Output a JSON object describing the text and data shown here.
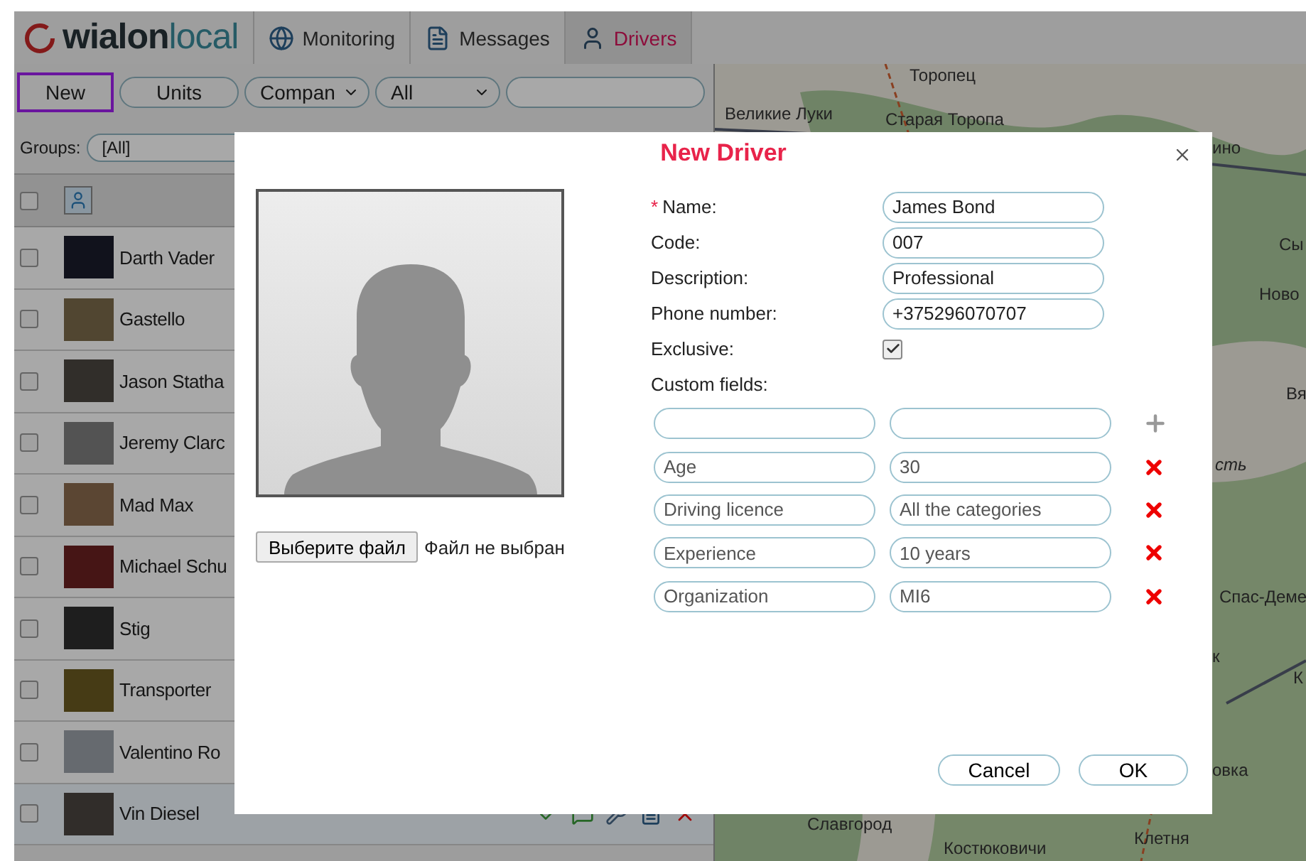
{
  "header": {
    "logo": {
      "part_1": "wialon",
      "part_2": "local"
    },
    "tabs": [
      {
        "label": "Monitoring",
        "selected": false
      },
      {
        "label": "Messages",
        "selected": false
      },
      {
        "label": "Drivers",
        "selected": true
      }
    ]
  },
  "toolbar": {
    "new_button": {
      "label": "New",
      "highlighted": true
    },
    "units_button": {
      "label": "Units"
    },
    "dropdowns": [
      {
        "value": "Compan"
      },
      {
        "value": "All"
      }
    ]
  },
  "groups": {
    "label": "Groups:",
    "value": "[All]"
  },
  "select_all": {
    "checked": false
  },
  "drivers": [
    {
      "name": "Darth Vader",
      "checked": false,
      "hovered": false
    },
    {
      "name": "Gastello",
      "checked": false,
      "hovered": false
    },
    {
      "name": "Jason Statha",
      "checked": false,
      "hovered": false
    },
    {
      "name": "Jeremy Clarc",
      "checked": false,
      "hovered": false
    },
    {
      "name": "Mad Max",
      "checked": false,
      "hovered": false
    },
    {
      "name": "Michael Schu",
      "checked": false,
      "hovered": false
    },
    {
      "name": "Stig",
      "checked": false,
      "hovered": false
    },
    {
      "name": "Transporter",
      "checked": false,
      "hovered": false
    },
    {
      "name": "Valentino Ro",
      "checked": false,
      "hovered": false
    },
    {
      "name": "Vin Diesel",
      "checked": false,
      "hovered": true
    }
  ],
  "map_labels": [
    "Торопец",
    "Великие Луки",
    "Старая Торопа",
    "ино",
    "Сы",
    "Ново",
    "Вя",
    "сть",
    "Спас-Деме",
    "к",
    "К",
    "овка",
    "Славгород",
    "Костюковичи",
    "Клетня"
  ],
  "dialog": {
    "title": "New Driver",
    "required_mark": "*",
    "fields": [
      {
        "label": "Name:",
        "value": "James Bond",
        "required": true
      },
      {
        "label": "Code:",
        "value": "007",
        "required": false
      },
      {
        "label": "Description:",
        "value": "Professional",
        "required": false
      },
      {
        "label": "Phone number:",
        "value": "+375296070707",
        "required": false
      }
    ],
    "exclusive": {
      "label": "Exclusive:",
      "checked": true
    },
    "custom_fields_label": "Custom fields:",
    "custom_fields": [
      {
        "kind": "add"
      },
      {
        "kind": "remove",
        "name": "Age",
        "value": "30"
      },
      {
        "kind": "remove",
        "name": "Driving licence",
        "value": "All the categories"
      },
      {
        "kind": "remove",
        "name": "Experience",
        "value": "10 years"
      },
      {
        "kind": "remove",
        "name": "Organization",
        "value": "MI6"
      }
    ],
    "file_button": "Выберите файл",
    "file_status": "Файл не выбран",
    "buttons": {
      "cancel": "Cancel",
      "ok": "OK"
    }
  }
}
